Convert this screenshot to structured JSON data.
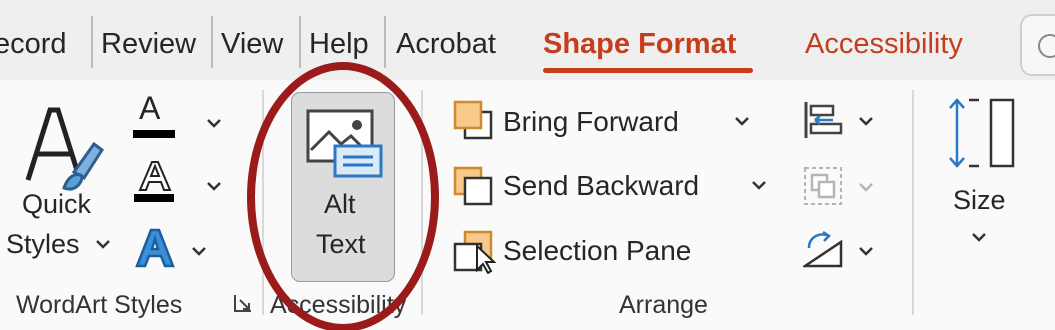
{
  "tabs": [
    {
      "label": "ecord"
    },
    {
      "label": "Review"
    },
    {
      "label": "View"
    },
    {
      "label": "Help"
    },
    {
      "label": "Acrobat"
    },
    {
      "label": "Shape Format"
    },
    {
      "label": "Accessibility"
    }
  ],
  "active_tab": "Shape Format",
  "colors": {
    "accent": "#c43e1c",
    "highlight": "#9b1b1b",
    "orange_fill": "#f7c98b",
    "blue": "#2b78c5"
  },
  "wordart": {
    "quick_styles_line1": "Quick",
    "quick_styles_line2": "Styles",
    "letter_fill": "A",
    "letter_outline": "A",
    "letter_effects": "A",
    "group_label": "WordArt Styles"
  },
  "accessibility": {
    "alt_line1": "Alt",
    "alt_line2": "Text",
    "group_label": "Accessibility"
  },
  "arrange": {
    "bring_forward": "Bring Forward",
    "send_backward": "Send Backward",
    "selection_pane": "Selection Pane",
    "group_label": "Arrange"
  },
  "size": {
    "label": "Size"
  },
  "icons": [
    "quick-styles-icon",
    "text-fill-icon",
    "text-outline-icon",
    "text-effects-icon",
    "alt-text-icon",
    "bring-forward-icon",
    "send-backward-icon",
    "selection-pane-icon",
    "align-icon",
    "group-icon",
    "rotate-icon",
    "size-icon",
    "dialog-launcher-icon",
    "search-icon"
  ]
}
